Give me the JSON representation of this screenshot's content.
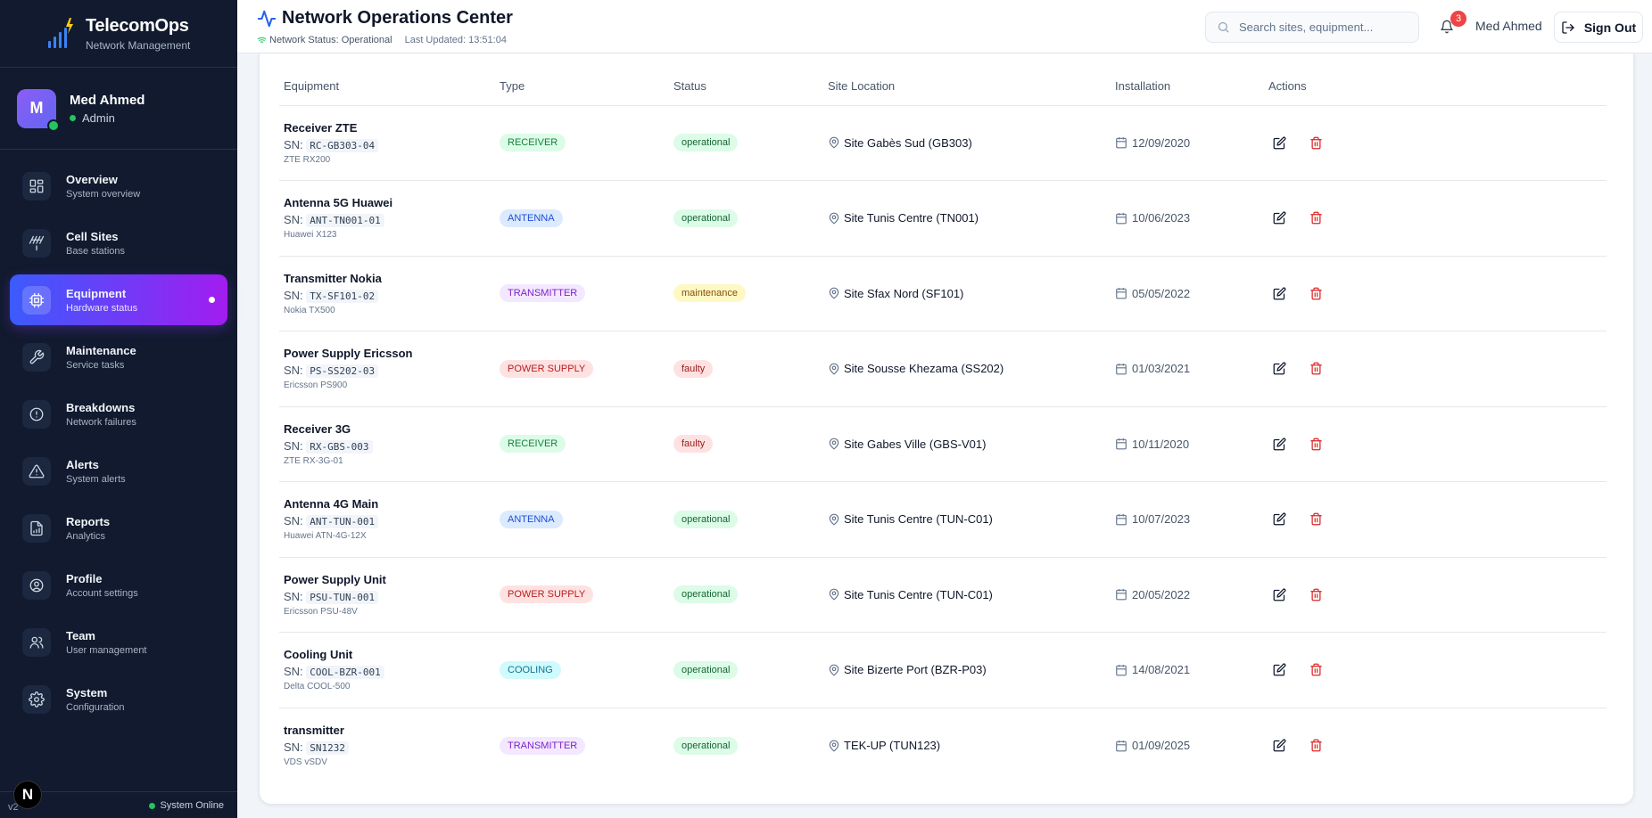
{
  "brand": {
    "title": "TelecomOps",
    "subtitle": "Network Management"
  },
  "user": {
    "initial": "M",
    "name": "Med Ahmed",
    "role": "Admin"
  },
  "nav": [
    {
      "label": "Overview",
      "sub": "System overview",
      "icon": "layout-grid-icon"
    },
    {
      "label": "Cell Sites",
      "sub": "Base stations",
      "icon": "antenna-icon"
    },
    {
      "label": "Equipment",
      "sub": "Hardware status",
      "icon": "cpu-icon",
      "active": true
    },
    {
      "label": "Maintenance",
      "sub": "Service tasks",
      "icon": "wrench-icon"
    },
    {
      "label": "Breakdowns",
      "sub": "Network failures",
      "icon": "alert-circle-icon"
    },
    {
      "label": "Alerts",
      "sub": "System alerts",
      "icon": "alert-triangle-icon"
    },
    {
      "label": "Reports",
      "sub": "Analytics",
      "icon": "file-chart-icon"
    },
    {
      "label": "Profile",
      "sub": "Account settings",
      "icon": "user-circle-icon"
    },
    {
      "label": "Team",
      "sub": "User management",
      "icon": "users-icon"
    },
    {
      "label": "System",
      "sub": "Configuration",
      "icon": "gear-icon"
    }
  ],
  "footer": {
    "version": "v2",
    "next_badge": "N",
    "status": "System Online"
  },
  "header": {
    "title": "Network Operations Center",
    "status": "Network Status: Operational",
    "updated": "Last Updated: 13:51:04",
    "search_placeholder": "Search sites, equipment...",
    "notifications": "3",
    "user_name": "Med Ahmed",
    "signout": "Sign Out"
  },
  "table": {
    "columns": [
      "Equipment",
      "Type",
      "Status",
      "Site Location",
      "Installation",
      "Actions"
    ],
    "sn_prefix": "SN:",
    "rows": [
      {
        "name": "Receiver ZTE",
        "sn": "RC-GB303-04",
        "model": "ZTE RX200",
        "type": "RECEIVER",
        "type_class": "type-receiver",
        "status": "operational",
        "site": "Site Gabès Sud (GB303)",
        "date": "12/09/2020"
      },
      {
        "name": "Antenna 5G Huawei",
        "sn": "ANT-TN001-01",
        "model": "Huawei X123",
        "type": "ANTENNA",
        "type_class": "type-antenna",
        "status": "operational",
        "site": "Site Tunis Centre (TN001)",
        "date": "10/06/2023"
      },
      {
        "name": "Transmitter Nokia",
        "sn": "TX-SF101-02",
        "model": "Nokia TX500",
        "type": "TRANSMITTER",
        "type_class": "type-transmitter",
        "status": "maintenance",
        "site": "Site Sfax Nord (SF101)",
        "date": "05/05/2022"
      },
      {
        "name": "Power Supply Ericsson",
        "sn": "PS-SS202-03",
        "model": "Ericsson PS900",
        "type": "POWER SUPPLY",
        "type_class": "type-power",
        "status": "faulty",
        "site": "Site Sousse Khezama (SS202)",
        "date": "01/03/2021"
      },
      {
        "name": "Receiver 3G",
        "sn": "RX-GBS-003",
        "model": "ZTE RX-3G-01",
        "type": "RECEIVER",
        "type_class": "type-receiver",
        "status": "faulty",
        "site": "Site Gabes Ville (GBS-V01)",
        "date": "10/11/2020"
      },
      {
        "name": "Antenna 4G Main",
        "sn": "ANT-TUN-001",
        "model": "Huawei ATN-4G-12X",
        "type": "ANTENNA",
        "type_class": "type-antenna",
        "status": "operational",
        "site": "Site Tunis Centre (TUN-C01)",
        "date": "10/07/2023"
      },
      {
        "name": "Power Supply Unit",
        "sn": "PSU-TUN-001",
        "model": "Ericsson PSU-48V",
        "type": "POWER SUPPLY",
        "type_class": "type-power",
        "status": "operational",
        "site": "Site Tunis Centre (TUN-C01)",
        "date": "20/05/2022"
      },
      {
        "name": "Cooling Unit",
        "sn": "COOL-BZR-001",
        "model": "Delta COOL-500",
        "type": "COOLING",
        "type_class": "type-cooling",
        "status": "operational",
        "site": "Site Bizerte Port (BZR-P03)",
        "date": "14/08/2021"
      },
      {
        "name": "transmitter",
        "sn": "SN1232",
        "model": "VDS vSDV",
        "type": "TRANSMITTER",
        "type_class": "type-transmitter",
        "status": "operational",
        "site": "TEK-UP (TUN123)",
        "date": "01/09/2025"
      }
    ]
  },
  "colors": {
    "accent_start": "#3b5bfd",
    "accent_end": "#a21cf0",
    "sidebar_bg": "#111a2e",
    "danger": "#dc2626",
    "online": "#22c55e"
  }
}
